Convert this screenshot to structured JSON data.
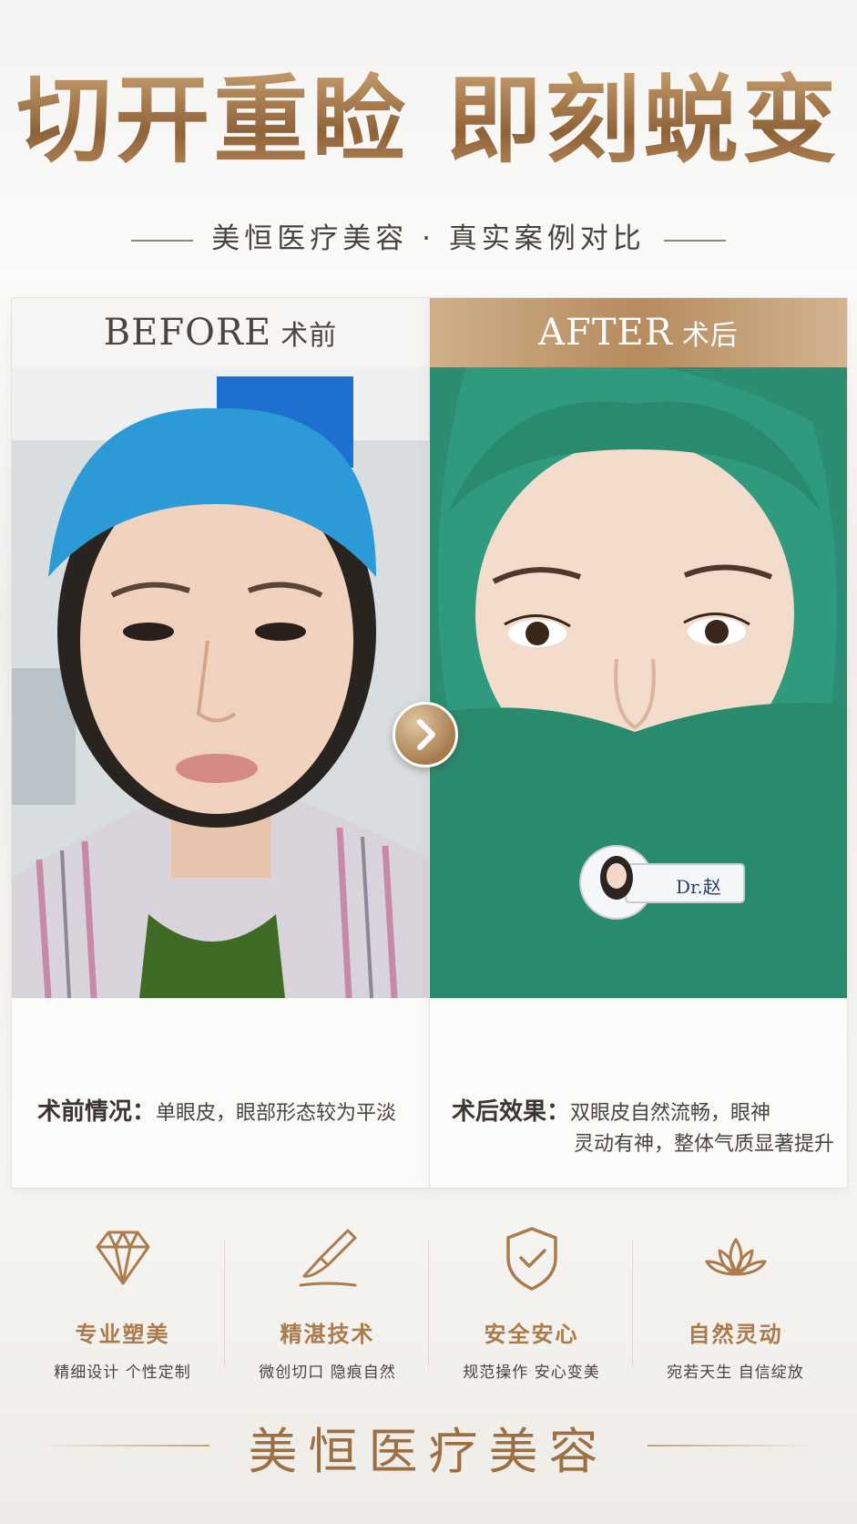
{
  "headline": "切开重睑 即刻蜕变",
  "subheadline": "美恒医疗美容 · 真实案例对比",
  "before": {
    "title_en": "BEFORE",
    "title_cn": "术前",
    "caption_label": "术前情况：",
    "caption_text": "单眼皮，眼部形态较为平淡"
  },
  "after": {
    "title_en": "AFTER",
    "title_cn": "术后",
    "caption_label": "术后效果：",
    "caption_line1": "双眼皮自然流畅，眼神",
    "caption_line2": "灵动有神，整体气质显著提升",
    "badge_text": "Dr.赵"
  },
  "features": [
    {
      "icon": "diamond-icon",
      "title": "专业塑美",
      "subtitle": "精细设计 个性定制"
    },
    {
      "icon": "scalpel-icon",
      "title": "精湛技术",
      "subtitle": "微创切口 隐痕自然"
    },
    {
      "icon": "shield-check-icon",
      "title": "安全安心",
      "subtitle": "规范操作 安心变美"
    },
    {
      "icon": "lotus-icon",
      "title": "自然灵动",
      "subtitle": "宛若天生 自信绽放"
    }
  ],
  "brand": "美恒医疗美容",
  "colors": {
    "gold": "#a97b4d",
    "gold_light": "#d0b08a",
    "scrub_green": "#2a8a6e",
    "cap_blue": "#1e8fd6"
  }
}
